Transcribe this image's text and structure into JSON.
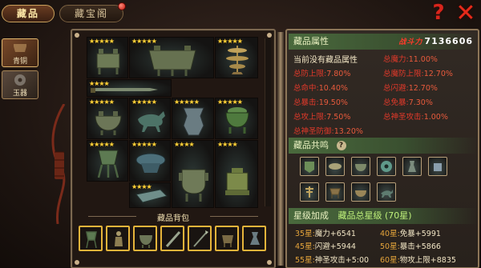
{
  "tabs": {
    "collection": "藏品",
    "treasury": "藏宝阁"
  },
  "icons": {
    "help": "help-question-icon",
    "close": "close-x-icon"
  },
  "side_tabs": [
    {
      "label": "青铜",
      "selected": true
    },
    {
      "label": "玉器",
      "selected": false
    }
  ],
  "grid": {
    "items": [
      {
        "name": "bronze-fang-ding",
        "stars": "★★★★★"
      },
      {
        "name": "bronze-large-ding",
        "stars": "★★★★★"
      },
      {
        "name": "bronze-lamp-tree",
        "stars": "★★★★★"
      },
      {
        "name": "bronze-sword",
        "stars": "★★★★"
      },
      {
        "name": "bronze-round-ding",
        "stars": "★★★★★"
      },
      {
        "name": "bronze-galloping-horse",
        "stars": "★★★★★"
      },
      {
        "name": "bronze-zun-vessel",
        "stars": "★★★★★"
      },
      {
        "name": "bronze-lidded-ding",
        "stars": "★★★★★"
      },
      {
        "name": "bronze-jue-cup",
        "stars": "★★★★★"
      },
      {
        "name": "bronze-pan-basin",
        "stars": "★★★★★"
      },
      {
        "name": "bronze-tray-slab",
        "stars": "★★★★"
      },
      {
        "name": "bronze-gui-vessel",
        "stars": "★★★★"
      },
      {
        "name": "bronze-seal-cube",
        "stars": "★★★★"
      }
    ]
  },
  "bag": {
    "title": "藏品背包",
    "slots": [
      "jue",
      "figure",
      "ding",
      "sword",
      "spear",
      "ding-small",
      "vessel"
    ]
  },
  "info": {
    "title": "藏品属性",
    "power_label": "战斗力",
    "power_value": "7136606",
    "empty_msg": "当前没有藏品属性",
    "attrs": [
      {
        "k": "总防上限:",
        "v": "7.80%"
      },
      {
        "k": "总魔力:",
        "v": "11.00%"
      },
      {
        "k": "总命中:",
        "v": "10.40%"
      },
      {
        "k": "总魔防上限:",
        "v": "12.70%"
      },
      {
        "k": "总暴击:",
        "v": "19.50%"
      },
      {
        "k": "总闪避:",
        "v": "12.70%"
      },
      {
        "k": "总攻上限:",
        "v": "7.50%"
      },
      {
        "k": "总免暴:",
        "v": "7.30%"
      },
      {
        "k": "总神圣防御:",
        "v": "13.20%"
      },
      {
        "k": "总神圣攻击:",
        "v": "1.00%"
      }
    ],
    "resonance_title": "藏品共鸣",
    "resonance_help": "?",
    "star_title": "星级加成",
    "star_total_label": "藏品总星级",
    "star_total_value": "(70星)",
    "star_bonus": [
      {
        "lvl": "35星:",
        "bon": "魔力+6541"
      },
      {
        "lvl": "40星:",
        "bon": "免暴+5991"
      },
      {
        "lvl": "45星:",
        "bon": "闪避+5944"
      },
      {
        "lvl": "50星:",
        "bon": "暴击+5866"
      },
      {
        "lvl": "55星:",
        "bon": "神圣攻击+5:00"
      },
      {
        "lvl": "60星:",
        "bon": "物攻上限+8835"
      }
    ]
  }
}
